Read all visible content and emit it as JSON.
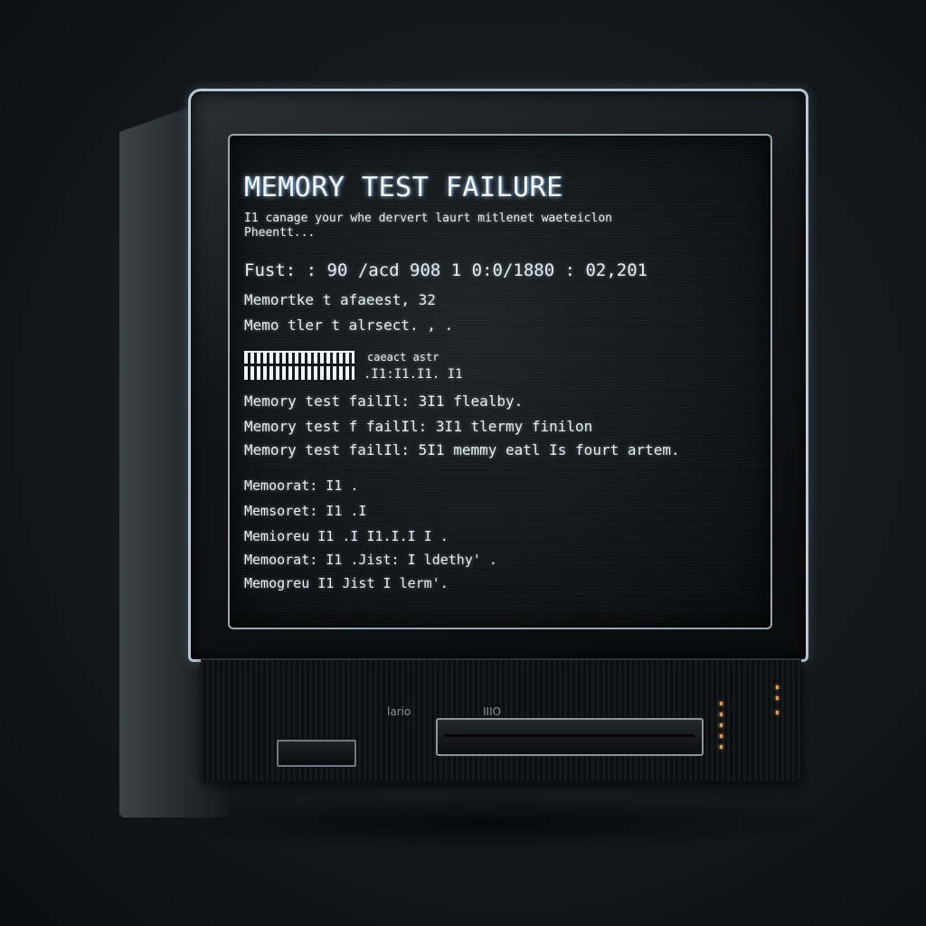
{
  "screen": {
    "title": "MEMORY TEST FAILURE",
    "subtitle_line1": "I1 canage your whe dervert laurt mitlenet waeteiclon",
    "subtitle_line2": "Pheentt...",
    "stats_line": "Fust: : 90 /acd  908  1 0:0/1880 : 02,201",
    "memory_line1": "Memortke t afaeest, 32",
    "memory_line2": "Memo tler t alrsect. , .",
    "progress_label1": "caeact astr",
    "progress_label2": ".I1:I1.I1. I1",
    "failures": [
      "Memory test failIl: 3I1 flealby.",
      "Memory test f failIl: 3I1 tlermy finilon",
      "Memory test failIl: 5I1  memmy eatl Is fourt artem."
    ],
    "records": [
      "Memoorat: I1 .",
      "Memsoret: I1 .I",
      "Memioreu I1 .I I1.I.I I .",
      "Memoorat: I1 .Jist: I ldethy' .",
      "Memogreu I1 Jist  I lerm'."
    ]
  },
  "base": {
    "label_left": "lario",
    "label_right": "IIIO"
  },
  "colors": {
    "screen_text": "#e8eef2",
    "bezel_edge": "#b9c7d3",
    "led": "#d8a060"
  }
}
